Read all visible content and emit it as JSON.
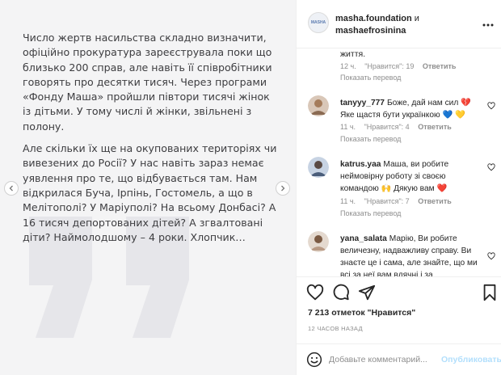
{
  "post": {
    "paragraphs": [
      "Число жертв насильства складно визначити, офіційно прокуратура зареєструвала поки що близько 200 справ, але навіть її співробітники говорять про десятки тисяч. Через програми «Фонду Маша» пройшли півтори тисячі жінок із дітьми. У тому числі й жінки, звільнені з полону.",
      "Але скільки їх ще на окупованих територіях чи вивезених до Росії? У нас навіть зараз немає уявлення про те, що відбувається там. Нам відкрилася Буча, Ірпінь, Гостомель, а що в Мелітополі? У Маріуполі? На всьому Донбасі? А 16 тисяч депортованих дітей? А згвалтовані діти? Наймолодшому – 4 роки. Хлопчик…"
    ]
  },
  "header": {
    "user1": "masha.foundation",
    "and": "и",
    "user2": "mashaefrosinina",
    "avatar_text": "MASHA"
  },
  "comments": {
    "cut_text": "життя.",
    "cut_meta": {
      "time": "12 ч.",
      "likes": "\"Нравится\": 19",
      "reply": "Ответить"
    },
    "show_translation": "Показать перевод",
    "items": [
      {
        "username": "tanyyy_777",
        "text": "Боже, дай нам сил 💔 Яке щастя бути українкою 💙 💛",
        "time": "11 ч.",
        "likes": "\"Нравится\": 4",
        "reply": "Ответить"
      },
      {
        "username": "katrus.yaa",
        "text": "Маша, ви робите неймовірну роботу зі своєю командою 🙌 Дякую вам ❤️",
        "time": "11 ч.",
        "likes": "\"Нравится\": 7",
        "reply": "Ответить"
      },
      {
        "username": "yana_salata",
        "text": "Марію, Ви робите величезну, надважливу справу. Ви знаєте це і сама, але знайте, що ми всі за неї вам вдячні і за"
      }
    ]
  },
  "stats": {
    "likes": "7 213 отметок \"Нравится\"",
    "time_ago": "12 ЧАСОВ НАЗАД"
  },
  "composer": {
    "placeholder": "Добавьте комментарий...",
    "publish": "Опубликовать"
  },
  "colors": {
    "accent": "#0095f6",
    "publish_disabled": "#b2dffc",
    "media_bg": "#f4f4f5"
  },
  "icons": [
    "chevron-left-icon",
    "chevron-right-icon",
    "more-icon",
    "heart-icon",
    "comment-icon",
    "share-icon",
    "bookmark-icon",
    "emoji-icon"
  ]
}
